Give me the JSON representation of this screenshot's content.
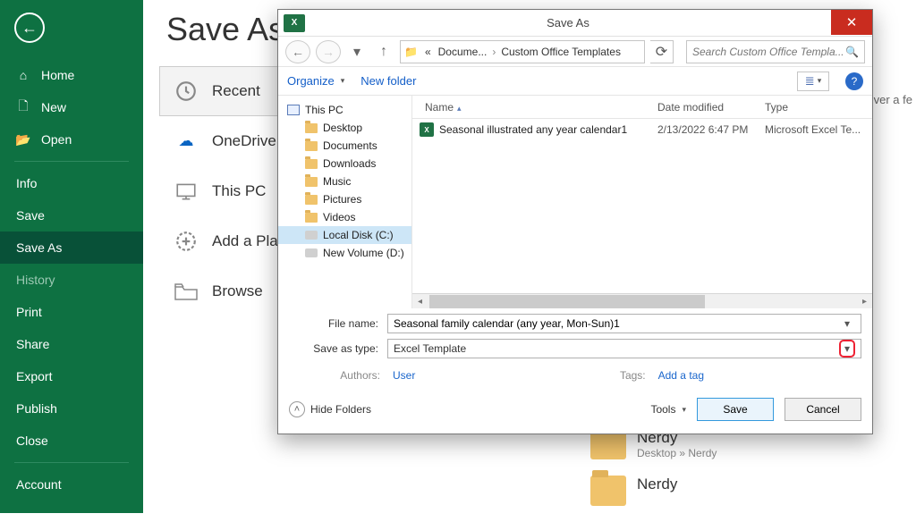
{
  "backstage": {
    "back": "←",
    "home": "Home",
    "new": "New",
    "open": "Open",
    "info": "Info",
    "save": "Save",
    "saveAs": "Save As",
    "history": "History",
    "print": "Print",
    "share": "Share",
    "export": "Export",
    "publish": "Publish",
    "close": "Close",
    "account": "Account"
  },
  "page": {
    "title": "Save As",
    "truncated": "over a fe",
    "places": {
      "recent": "Recent",
      "onedrive": "OneDrive",
      "thispc": "This PC",
      "addplace": "Add a Plac",
      "browse": "Browse"
    },
    "current": {
      "name": "Nerdy",
      "path": "Desktop » Nerdy"
    },
    "current2": {
      "name": "Nerdy"
    }
  },
  "dialog": {
    "title": "Save As",
    "close": "✕",
    "nav": {
      "back": "←",
      "forward": "→",
      "recent": "▾",
      "up": "↑"
    },
    "breadcrumb": {
      "c1": "Docume...",
      "c2": "Custom Office Templates"
    },
    "refresh": "⟳",
    "search": {
      "placeholder": "Search Custom Office Templa...",
      "icon": "🔍"
    },
    "toolbar": {
      "organize": "Organize",
      "newFolder": "New folder",
      "view": "≣",
      "help": "?"
    },
    "tree": {
      "root": "This PC",
      "desktop": "Desktop",
      "documents": "Documents",
      "downloads": "Downloads",
      "music": "Music",
      "pictures": "Pictures",
      "videos": "Videos",
      "localDisk": "Local Disk (C:)",
      "newVolume": "New Volume (D:)"
    },
    "columns": {
      "name": "Name",
      "date": "Date modified",
      "type": "Type"
    },
    "files": [
      {
        "name": "Seasonal illustrated any year calendar1",
        "date": "2/13/2022 6:47 PM",
        "type": "Microsoft Excel Te..."
      }
    ],
    "form": {
      "fileNameLabel": "File name:",
      "fileName": "Seasonal family calendar (any year, Mon-Sun)1",
      "saveTypeLabel": "Save as type:",
      "saveType": "Excel Template",
      "authorsLabel": "Authors:",
      "authors": "User",
      "tagsLabel": "Tags:",
      "tags": "Add a tag"
    },
    "footer": {
      "hideFolders": "Hide Folders",
      "tools": "Tools",
      "save": "Save",
      "cancel": "Cancel"
    }
  }
}
